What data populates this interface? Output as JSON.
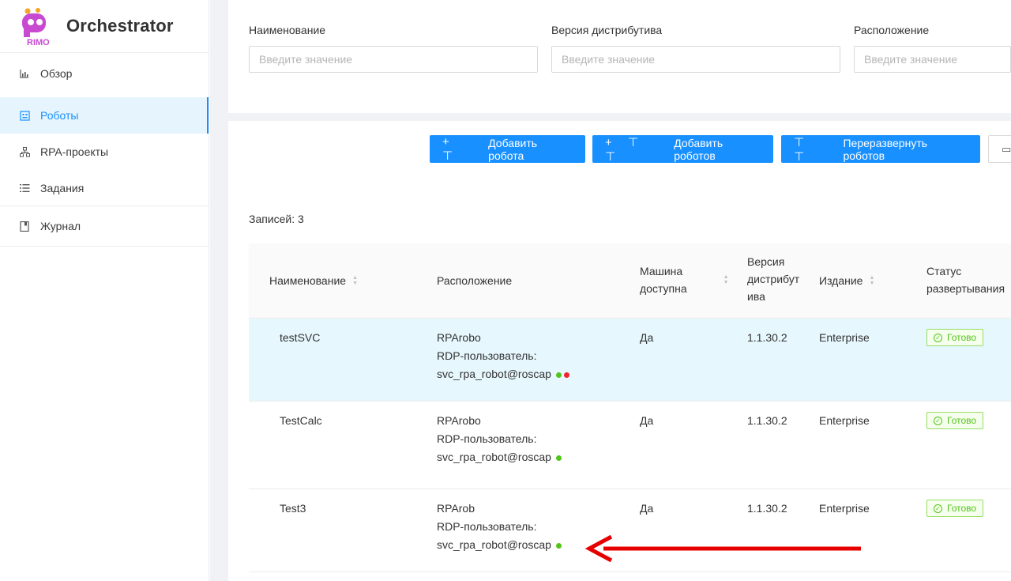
{
  "app": {
    "title": "Orchestrator",
    "logo_text": "RIMO"
  },
  "sidebar": {
    "items": [
      {
        "label": "Обзор",
        "icon": "chart-icon"
      },
      {
        "label": "Роботы",
        "icon": "robot-icon",
        "active": true
      },
      {
        "label": "RPA-проекты",
        "icon": "project-tree-icon"
      },
      {
        "label": "Задания",
        "icon": "list-icon"
      },
      {
        "label": "Журнал",
        "icon": "journal-icon"
      }
    ]
  },
  "filters": [
    {
      "label": "Наименование",
      "placeholder": "Введите значение"
    },
    {
      "label": "Версия дистрибутива",
      "placeholder": "Введите значение"
    },
    {
      "label": "Расположение",
      "placeholder": "Введите значение"
    }
  ],
  "toolbar": {
    "add_robot": "Добавить робота",
    "add_robots": "Добавить роботов",
    "redeploy": "Переразвернуть роботов"
  },
  "records_label": "Записей: 3",
  "table": {
    "columns": {
      "name": "Наименование",
      "location": "Расположение",
      "machine_l1": "Машина",
      "machine_l2": "доступна",
      "version_l1": "Версия",
      "version_l2": "дистрибут",
      "version_l3": "ива",
      "edition": "Издание",
      "status_l1": "Статус",
      "status_l2": "развертывания"
    },
    "rows": [
      {
        "name": "testSVC",
        "loc1": "RPArobo",
        "loc2": "RDP-пользователь:",
        "loc3": "svc_rpa_robot@roscap",
        "machine": "Да",
        "version": "1.1.30.2",
        "edition": "Enterprise",
        "status": "Готово",
        "dots": [
          "#52c41a",
          "#f5222d"
        ]
      },
      {
        "name": "TestCalc",
        "loc1": "RPArobo",
        "loc2": "RDP-пользователь:",
        "loc3": "svc_rpa_robot@roscap",
        "machine": "Да",
        "version": "1.1.30.2",
        "edition": "Enterprise",
        "status": "Готово",
        "dots": [
          "#52c41a"
        ]
      },
      {
        "name": "Test3",
        "loc1": "RPArob",
        "loc2": "RDP-пользователь:",
        "loc3": "svc_rpa_robot@roscap",
        "machine": "Да",
        "version": "1.1.30.2",
        "edition": "Enterprise",
        "status": "Готово",
        "dots": [
          "#52c41a"
        ]
      }
    ]
  },
  "colors": {
    "primary": "#1890ff",
    "success": "#52c41a",
    "error": "#f5222d",
    "annotation_arrow": "#e60000"
  }
}
